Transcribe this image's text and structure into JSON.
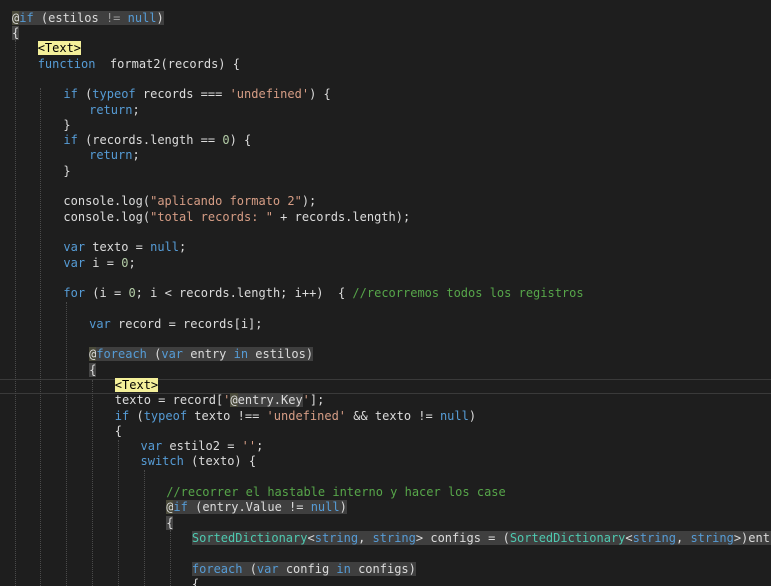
{
  "colors": {
    "background": "#1e1e1e",
    "keyword": "#569cd6",
    "string": "#d69d85",
    "comment": "#57a64a",
    "type": "#4ec9b0",
    "razor_tag_highlight": "#f4f09a"
  },
  "code_lines": [
    {
      "indent": 0,
      "parts": [
        [
          "rz",
          "@"
        ],
        [
          "rzk kw",
          "if"
        ],
        [
          "rzk",
          " (estilos "
        ],
        [
          "rzk dim",
          "!="
        ],
        [
          "rzk",
          " "
        ],
        [
          "rzk kw",
          "null"
        ],
        [
          "rzk",
          ")"
        ]
      ]
    },
    {
      "indent": 0,
      "parts": [
        [
          "cur2",
          "{"
        ]
      ]
    },
    {
      "indent": 1,
      "parts": [
        [
          "tag",
          "<Text>"
        ]
      ]
    },
    {
      "indent": 1,
      "parts": [
        [
          "kw",
          "function"
        ],
        [
          "",
          "  format2(records) {"
        ]
      ]
    },
    {
      "indent": 0,
      "parts": []
    },
    {
      "indent": 2,
      "parts": [
        [
          "kw",
          "if"
        ],
        [
          "",
          " ("
        ],
        [
          "kw",
          "typeof"
        ],
        [
          "",
          " records === "
        ],
        [
          "str",
          "'undefined'"
        ],
        [
          "",
          ") {"
        ]
      ]
    },
    {
      "indent": 3,
      "parts": [
        [
          "kw",
          "return"
        ],
        [
          "",
          ";"
        ]
      ]
    },
    {
      "indent": 2,
      "parts": [
        [
          "",
          "}"
        ]
      ]
    },
    {
      "indent": 2,
      "parts": [
        [
          "kw",
          "if"
        ],
        [
          "",
          " (records.length == "
        ],
        [
          "num",
          "0"
        ],
        [
          "",
          ") {"
        ]
      ]
    },
    {
      "indent": 3,
      "parts": [
        [
          "kw",
          "return"
        ],
        [
          "",
          ";"
        ]
      ]
    },
    {
      "indent": 2,
      "parts": [
        [
          "",
          "}"
        ]
      ]
    },
    {
      "indent": 0,
      "parts": []
    },
    {
      "indent": 2,
      "parts": [
        [
          "",
          "console.log("
        ],
        [
          "str",
          "\"aplicando formato 2\""
        ],
        [
          "",
          ");"
        ]
      ]
    },
    {
      "indent": 2,
      "parts": [
        [
          "",
          "console.log("
        ],
        [
          "str",
          "\"total records: \""
        ],
        [
          "",
          " + records.length);"
        ]
      ]
    },
    {
      "indent": 0,
      "parts": []
    },
    {
      "indent": 2,
      "parts": [
        [
          "kw",
          "var"
        ],
        [
          "",
          " texto = "
        ],
        [
          "kw",
          "null"
        ],
        [
          "",
          ";"
        ]
      ]
    },
    {
      "indent": 2,
      "parts": [
        [
          "kw",
          "var"
        ],
        [
          "",
          " i = "
        ],
        [
          "num",
          "0"
        ],
        [
          "",
          ";"
        ]
      ]
    },
    {
      "indent": 0,
      "parts": []
    },
    {
      "indent": 2,
      "parts": [
        [
          "kw",
          "for"
        ],
        [
          "",
          " (i = "
        ],
        [
          "num",
          "0"
        ],
        [
          "",
          "; i < records.length; i++)  { "
        ],
        [
          "cm",
          "//recorremos todos los registros"
        ]
      ]
    },
    {
      "indent": 0,
      "parts": []
    },
    {
      "indent": 3,
      "parts": [
        [
          "kw",
          "var"
        ],
        [
          "",
          " record = records[i];"
        ]
      ]
    },
    {
      "indent": 0,
      "parts": []
    },
    {
      "indent": 3,
      "parts": [
        [
          "rz",
          "@"
        ],
        [
          "rzk kw",
          "foreach"
        ],
        [
          "rzk",
          " ("
        ],
        [
          "rzk kw",
          "var"
        ],
        [
          "rzk",
          " entry "
        ],
        [
          "rzk kw",
          "in"
        ],
        [
          "rzk",
          " estilos)"
        ]
      ]
    },
    {
      "indent": 3,
      "parts": [
        [
          "cur2",
          "{"
        ]
      ]
    },
    {
      "indent": 4,
      "parts": [
        [
          "tag",
          "<Text>"
        ]
      ]
    },
    {
      "indent": 4,
      "parts": [
        [
          "",
          "texto = record["
        ],
        [
          "str",
          "'"
        ],
        [
          "rz",
          "@"
        ],
        [
          "rzk",
          "entry.Key"
        ],
        [
          "str",
          "'"
        ],
        [
          "",
          "];"
        ]
      ]
    },
    {
      "indent": 4,
      "parts": [
        [
          "kw",
          "if"
        ],
        [
          "",
          " ("
        ],
        [
          "kw",
          "typeof"
        ],
        [
          "",
          " texto !== "
        ],
        [
          "str",
          "'undefined'"
        ],
        [
          "",
          " && texto != "
        ],
        [
          "kw",
          "null"
        ],
        [
          "",
          ")"
        ]
      ]
    },
    {
      "indent": 4,
      "parts": [
        [
          "",
          "{"
        ]
      ]
    },
    {
      "indent": 5,
      "parts": [
        [
          "kw",
          "var"
        ],
        [
          "",
          " estilo2 = "
        ],
        [
          "str",
          "''"
        ],
        [
          "",
          ";"
        ]
      ]
    },
    {
      "indent": 5,
      "parts": [
        [
          "kw",
          "switch"
        ],
        [
          "",
          " (texto) {"
        ]
      ]
    },
    {
      "indent": 0,
      "parts": []
    },
    {
      "indent": 6,
      "parts": [
        [
          "cm",
          "//recorrer el hastable interno y hacer los case"
        ]
      ]
    },
    {
      "indent": 6,
      "parts": [
        [
          "rz",
          "@"
        ],
        [
          "rzk kw",
          "if"
        ],
        [
          "rzk",
          " (entry.Value != "
        ],
        [
          "rzk kw",
          "null"
        ],
        [
          "rzk",
          ")"
        ]
      ]
    },
    {
      "indent": 6,
      "parts": [
        [
          "cur2",
          "{"
        ]
      ]
    },
    {
      "indent": 7,
      "parts": [
        [
          "rzk ty",
          "SortedDictionary"
        ],
        [
          "rzk",
          "<"
        ],
        [
          "rzk kw",
          "string"
        ],
        [
          "rzk",
          ", "
        ],
        [
          "rzk kw",
          "string"
        ],
        [
          "rzk",
          "> configs = ("
        ],
        [
          "rzk ty",
          "SortedDictionary"
        ],
        [
          "rzk",
          "<"
        ],
        [
          "rzk kw",
          "string"
        ],
        [
          "rzk",
          ", "
        ],
        [
          "rzk kw",
          "string"
        ],
        [
          "rzk",
          ">)entry.Value;"
        ]
      ]
    },
    {
      "indent": 0,
      "parts": []
    },
    {
      "indent": 7,
      "parts": [
        [
          "rzk kw",
          "foreach"
        ],
        [
          "rzk",
          " ("
        ],
        [
          "rzk kw",
          "var"
        ],
        [
          "rzk",
          " config "
        ],
        [
          "rzk kw",
          "in"
        ],
        [
          "rzk",
          " configs)"
        ]
      ]
    },
    {
      "indent": 7,
      "parts": [
        [
          "",
          "{"
        ]
      ]
    }
  ]
}
